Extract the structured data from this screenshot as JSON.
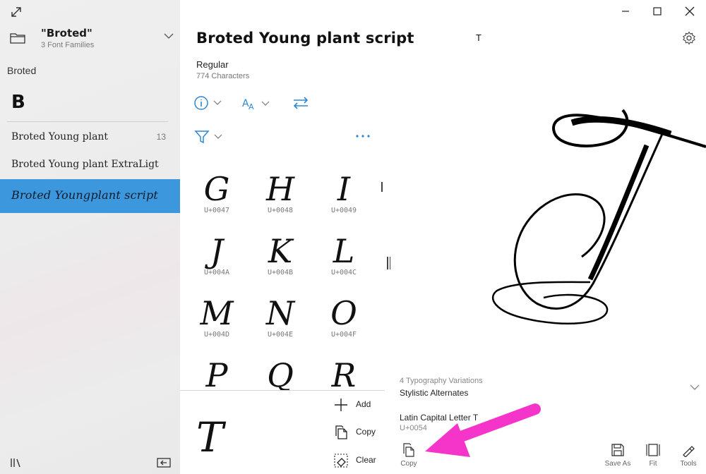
{
  "sidebar": {
    "family_title": "\"Broted\"",
    "family_subtitle": "3 Font Families",
    "collection_label": "Broted",
    "letter_header": "B",
    "fonts": [
      {
        "name": "Broted Young plant",
        "count": "13"
      },
      {
        "name": "Broted Young plant ExtraLigt",
        "count": ""
      },
      {
        "name": "Broted Youngplant script",
        "count": ""
      }
    ],
    "selected_index": 2
  },
  "main": {
    "title": "Broted Young plant script",
    "style": "Regular",
    "character_count": "774 Characters",
    "toolbar_icons": [
      "info-icon",
      "font-size-icon",
      "swap-arrows-icon",
      "filter-icon",
      "more-options-icon"
    ],
    "glyphs": [
      {
        "char": "G",
        "code": "U+0047"
      },
      {
        "char": "H",
        "code": "U+0048"
      },
      {
        "char": "I",
        "code": "U+0049"
      },
      {
        "char": "J",
        "code": "U+004A"
      },
      {
        "char": "K",
        "code": "U+004B"
      },
      {
        "char": "L",
        "code": "U+004C"
      },
      {
        "char": "M",
        "code": "U+004D"
      },
      {
        "char": "N",
        "code": "U+004E"
      },
      {
        "char": "O",
        "code": "U+004F"
      },
      {
        "char": "P",
        "code": ""
      },
      {
        "char": "Q",
        "code": ""
      },
      {
        "char": "R",
        "code": ""
      }
    ],
    "preview_char": "T",
    "actions": {
      "add": "Add",
      "copy": "Copy",
      "clear": "Clear"
    }
  },
  "detail": {
    "title_char": "T",
    "variations_count": "4 Typography Variations",
    "variations_name": "Stylistic Alternates",
    "char_name": "Latin Capital Letter T",
    "char_code": "U+0054",
    "buttons": {
      "copy": "Copy",
      "save_as": "Save As",
      "fit": "Fit",
      "tools": "Tools"
    }
  },
  "colors": {
    "accent": "#3d97dc",
    "icon_blue": "#2b88d8",
    "annotation": "#f535c9"
  }
}
